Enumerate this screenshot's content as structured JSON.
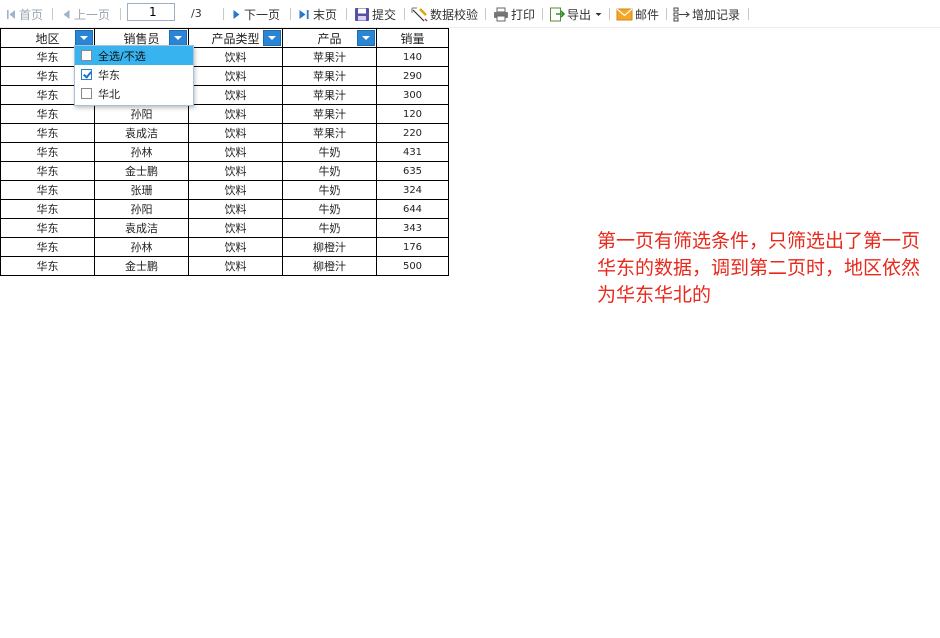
{
  "toolbar": {
    "first_label": "首页",
    "prev_label": "上一页",
    "page_value": "1",
    "page_total": "/3",
    "next_label": "下一页",
    "last_label": "末页",
    "submit_label": "提交",
    "verify_label": "数据校验",
    "print_label": "打印",
    "export_label": "导出",
    "mail_label": "邮件",
    "add_record_label": "增加记录"
  },
  "table": {
    "headers": [
      "地区",
      "销售员",
      "产品类型",
      "产品",
      "销量"
    ],
    "rows": [
      [
        "华东",
        "",
        "饮料",
        "苹果汁",
        "140"
      ],
      [
        "华东",
        "",
        "饮料",
        "苹果汁",
        "290"
      ],
      [
        "华东",
        "",
        "饮料",
        "苹果汁",
        "300"
      ],
      [
        "华东",
        "孙阳",
        "饮料",
        "苹果汁",
        "120"
      ],
      [
        "华东",
        "袁成洁",
        "饮料",
        "苹果汁",
        "220"
      ],
      [
        "华东",
        "孙林",
        "饮料",
        "牛奶",
        "431"
      ],
      [
        "华东",
        "金士鹏",
        "饮料",
        "牛奶",
        "635"
      ],
      [
        "华东",
        "张珊",
        "饮料",
        "牛奶",
        "324"
      ],
      [
        "华东",
        "孙阳",
        "饮料",
        "牛奶",
        "644"
      ],
      [
        "华东",
        "袁成洁",
        "饮料",
        "牛奶",
        "343"
      ],
      [
        "华东",
        "孙林",
        "饮料",
        "柳橙汁",
        "176"
      ],
      [
        "华东",
        "金士鹏",
        "饮料",
        "柳橙汁",
        "500"
      ]
    ]
  },
  "filter_dropdown": {
    "options": [
      {
        "label": "全选/不选",
        "checked": false
      },
      {
        "label": "华东",
        "checked": true
      },
      {
        "label": "华北",
        "checked": false
      }
    ]
  },
  "note": "第一页有筛选条件，只筛选出了第一页 华东的数据，调到第二页时，地区依然为华东华北的",
  "colors": {
    "accent": "#2a86d4",
    "dropdown_highlight": "#37b4f0",
    "note": "#e8291c"
  }
}
